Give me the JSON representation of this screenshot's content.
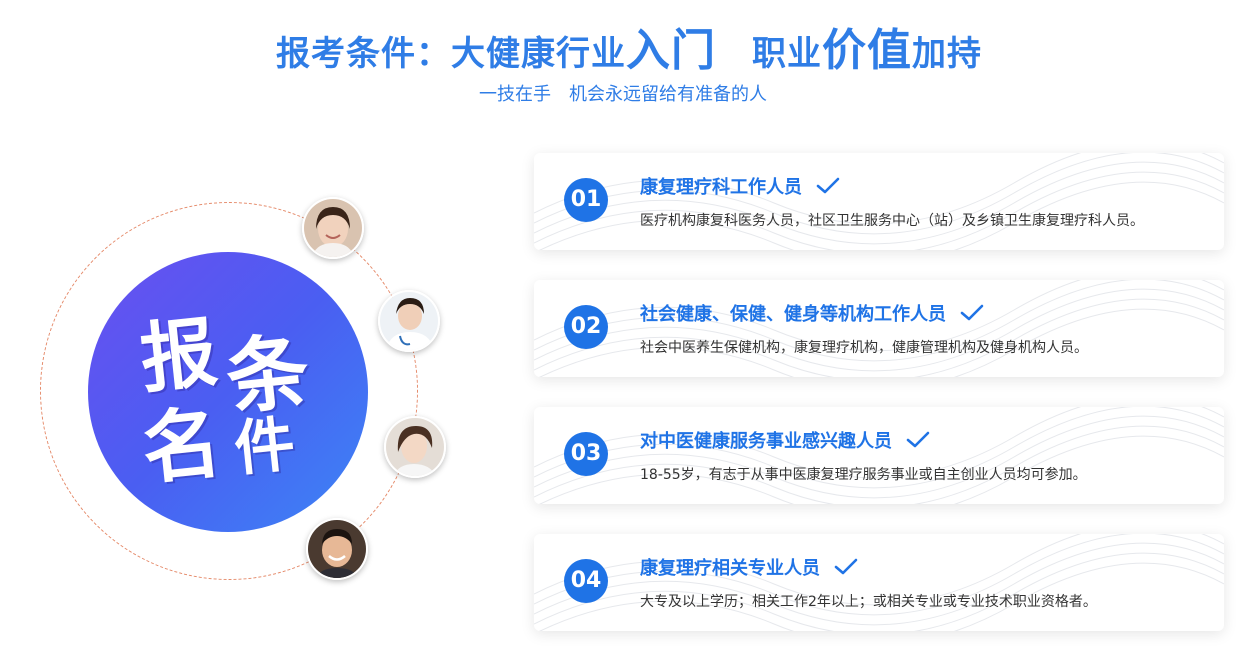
{
  "header": {
    "title_part1": "报考条件：大健康行业",
    "title_big1": "入门",
    "title_part2": "职业",
    "title_big2": "价值",
    "title_part3": "加持",
    "subtitle_part1": "一技在手",
    "subtitle_part2": "机会永远留给有准备的人"
  },
  "badge": {
    "chars": [
      "报",
      "条",
      "名",
      "件"
    ]
  },
  "avatars": [
    "woman-smiling-avatar",
    "nurse-avatar",
    "woman-avatar",
    "man-smiling-avatar"
  ],
  "colors": {
    "accent": "#2f7de6",
    "number_circle": "#1f73e6",
    "badge_gradient_start": "#6a4ff0",
    "badge_gradient_end": "#3c86f5",
    "orbit": "#e58b6b"
  },
  "cards": [
    {
      "number": "01",
      "title": "康复理疗科工作人员",
      "desc": "医疗机构康复科医务人员，社区卫生服务中心（站）及乡镇卫生康复理疗科人员。"
    },
    {
      "number": "02",
      "title": "社会健康、保健、健身等机构工作人员",
      "desc": "社会中医养生保健机构，康复理疗机构，健康管理机构及健身机构人员。"
    },
    {
      "number": "03",
      "title": "对中医健康服务事业感兴趣人员",
      "desc": "18-55岁，有志于从事中医康复理疗服务事业或自主创业人员均可参加。"
    },
    {
      "number": "04",
      "title": "康复理疗相关专业人员",
      "desc": "大专及以上学历；相关工作2年以上；或相关专业或专业技术职业资格者。"
    }
  ]
}
